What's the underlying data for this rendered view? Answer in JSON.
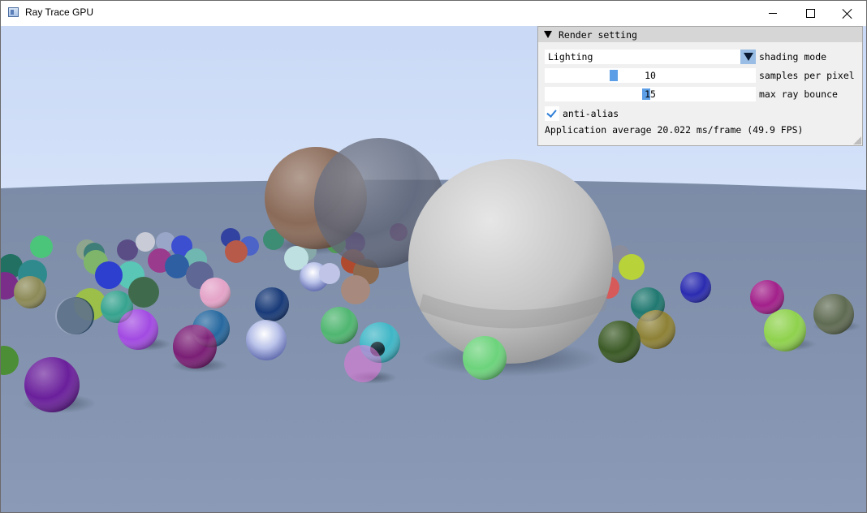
{
  "window": {
    "title": "Ray Trace GPU",
    "controls": {
      "minimize": "minimize-icon",
      "maximize": "maximize-icon",
      "close": "close-icon"
    }
  },
  "panel": {
    "title": "Render setting",
    "shading_mode": {
      "value": "Lighting",
      "label": "shading mode"
    },
    "samples_per_pixel": {
      "value": "10",
      "label": "samples per pixel",
      "level": 0.32
    },
    "max_ray_bounce": {
      "value": "15",
      "label": "max ray bounce",
      "level": 0.48
    },
    "anti_alias": {
      "label": "anti-alias",
      "checked": true
    },
    "fps_text": "Application average 20.022 ms/frame (49.9 FPS)"
  },
  "colors": {
    "accent": "#5c9fe6",
    "combo_button": "#99bde4",
    "panel_bg": "#f0f0f0",
    "panel_header": "#d6d6d6",
    "sky": "#dde8fb",
    "ground": "#8a9ab4"
  }
}
